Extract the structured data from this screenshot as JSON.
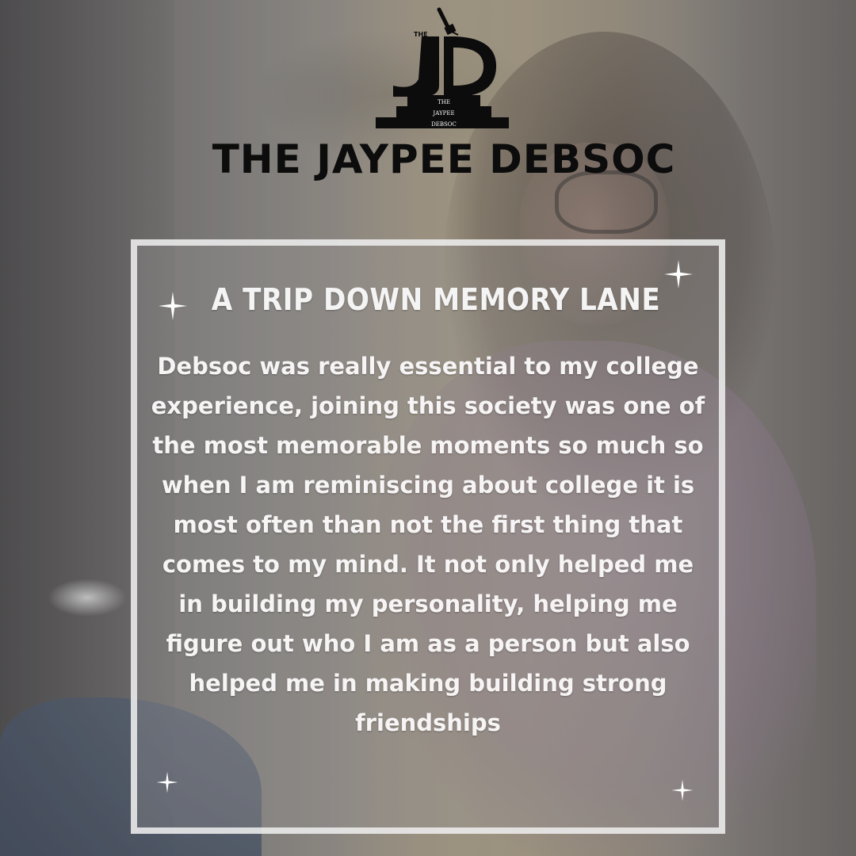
{
  "logo": {
    "the_label": "THE",
    "monogram": "JD",
    "step_lines": [
      "THE",
      "JAYPEE",
      "DEBSOC"
    ]
  },
  "header": {
    "title": "THE JAYPEE DEBSOC"
  },
  "card": {
    "title": "A TRIP DOWN MEMORY LANE",
    "body": "Debsoc was really essential to my college experience, joining this society was one of the most memorable moments so much so when I am reminiscing about college it is most often than not the first thing that comes to my mind. It not only helped me in building my personality, helping me figure out who I am as a person but also helped me in making building strong friendships"
  },
  "colors": {
    "title_text": "#0c0c0c",
    "card_text": "#f6f4f4",
    "frame": "#f0f0f0"
  },
  "icons": [
    "microphone-icon",
    "sparkle-icon"
  ]
}
